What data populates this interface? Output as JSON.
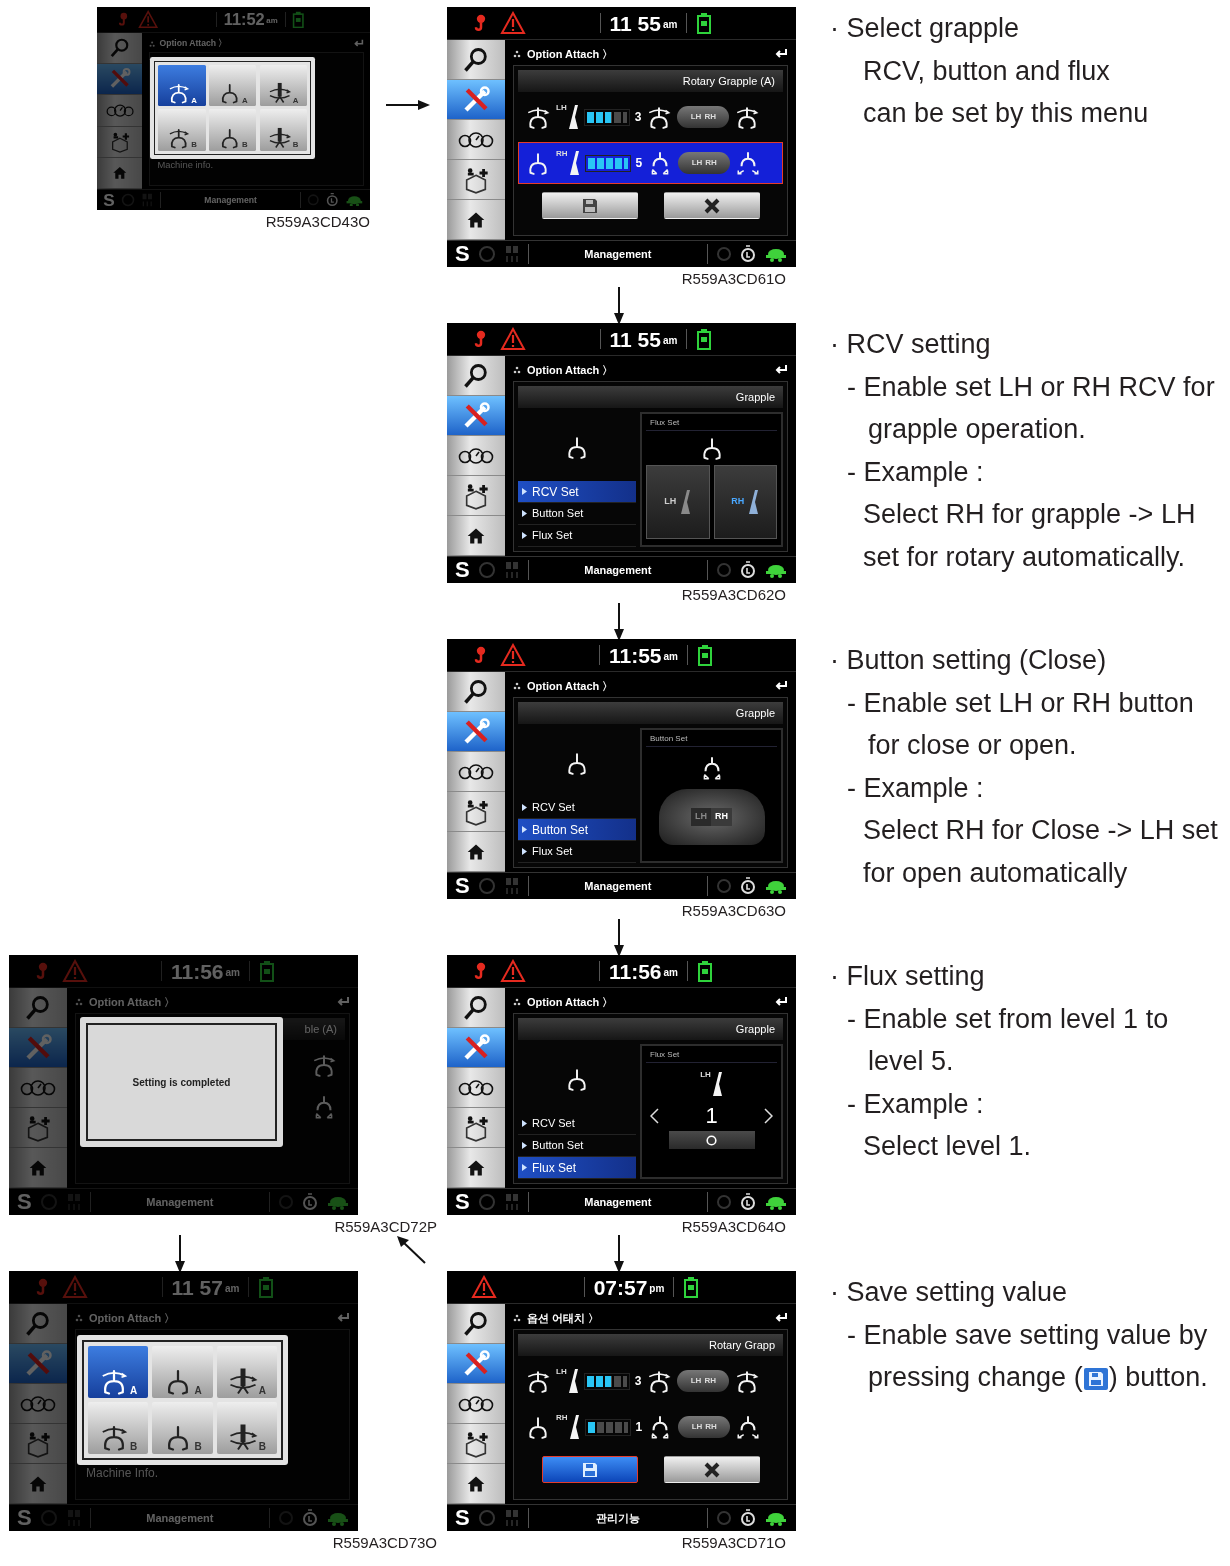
{
  "steps": [
    {
      "left": {
        "time": "11:52",
        "meridiem": "am",
        "hook_warning": true,
        "header": "Option Attach 〉",
        "footer_letter": "S",
        "footer": "Management",
        "dimmed": true,
        "sidebar": [
          {
            "selected": false
          },
          {
            "selected": true
          },
          {
            "selected": false
          },
          {
            "selected": false
          },
          {
            "selected": false
          }
        ],
        "content": {
          "kind": "list",
          "items": [
            "Machine info."
          ]
        },
        "popup": {
          "kind": "picker",
          "tiles": [
            {
              "kind": "rotary",
              "sub": "A",
              "selected": true
            },
            {
              "kind": "grapple",
              "sub": "A",
              "selected": false
            },
            {
              "kind": "rotator",
              "sub": "A",
              "selected": false
            },
            {
              "kind": "rotary",
              "sub": "B",
              "selected": false
            },
            {
              "kind": "grapple",
              "sub": "B",
              "selected": false
            },
            {
              "kind": "rotator",
              "sub": "B",
              "selected": false
            }
          ]
        },
        "caption": "R559A3CD43O"
      },
      "center": {
        "time": "11 55",
        "meridiem": "am",
        "hook_warning": true,
        "header": "Option Attach 〉",
        "footer_letter": "S",
        "footer": "Management",
        "dimmed": false,
        "sidebar": [
          {
            "selected": false
          },
          {
            "selected": true
          },
          {
            "selected": false
          },
          {
            "selected": false
          },
          {
            "selected": false
          }
        ],
        "content": {
          "kind": "rows",
          "title": "Rotary Grapple (A)",
          "rows": [
            {
              "kind": "rotation",
              "lever": "LH",
              "level": 0.6,
              "reading": "3",
              "switch": [
                "LH",
                "RH"
              ],
              "selected": false
            },
            {
              "kind": "grip",
              "lever": "RH",
              "level": 1,
              "reading": "5",
              "switch": [
                "LH",
                "RH"
              ],
              "selected": true
            }
          ],
          "save_selected": false
        },
        "caption": "R559A3CD61O"
      },
      "note": {
        "heading": "· Select grapple",
        "items": [
          {
            "kind": "plain",
            "text": "RCV, button and flux"
          },
          {
            "kind": "plain",
            "text": "can be set by this menu"
          }
        ]
      }
    },
    {
      "center": {
        "time": "11 55",
        "meridiem": "am",
        "hook_warning": true,
        "header": "Option Attach 〉",
        "footer_letter": "S",
        "footer": "Management",
        "dimmed": false,
        "sidebar": [
          {
            "selected": false
          },
          {
            "selected": true
          },
          {
            "selected": false
          },
          {
            "selected": false
          },
          {
            "selected": false
          }
        ],
        "content": {
          "kind": "menu",
          "title": "Grapple",
          "items": [
            {
              "label": "RCV Set",
              "selected": true
            },
            {
              "label": "Button Set",
              "selected": false
            },
            {
              "label": "Flux Set",
              "selected": false
            }
          ],
          "panel": {
            "kind": "rcv",
            "title": "Flux Set",
            "options": [
              {
                "label": "LH",
                "selected": false
              },
              {
                "label": "RH",
                "selected": true
              }
            ]
          }
        },
        "caption": "R559A3CD62O"
      },
      "note": {
        "heading": "· RCV setting",
        "items": [
          {
            "kind": "dash",
            "text": "- Enable set LH or RH RCV for grapple operation."
          },
          {
            "kind": "dash",
            "text": "- Example :"
          },
          {
            "kind": "plain",
            "text": "Select RH for grapple -> LH set for rotary automatically."
          }
        ]
      }
    },
    {
      "center": {
        "time": "11:55",
        "meridiem": "am",
        "hook_warning": true,
        "header": "Option Attach 〉",
        "footer_letter": "S",
        "footer": "Management",
        "dimmed": false,
        "sidebar": [
          {
            "selected": false
          },
          {
            "selected": true
          },
          {
            "selected": false
          },
          {
            "selected": false
          },
          {
            "selected": false
          }
        ],
        "content": {
          "kind": "menu",
          "title": "Grapple",
          "items": [
            {
              "label": "RCV Set",
              "selected": false
            },
            {
              "label": "Button Set",
              "selected": true
            },
            {
              "label": "Flux Set",
              "selected": false
            }
          ],
          "panel": {
            "kind": "button",
            "title": "Button Set",
            "options": [
              {
                "label": "LH",
                "selected": false
              },
              {
                "label": "RH",
                "selected": true
              }
            ]
          }
        },
        "caption": "R559A3CD63O"
      },
      "note": {
        "heading": "· Button setting (Close)",
        "items": [
          {
            "kind": "dash",
            "text": "- Enable set LH or RH button for close or open."
          },
          {
            "kind": "dash",
            "text": "- Example :"
          },
          {
            "kind": "plain",
            "text": "Select RH for Close -> LH set for open automatically"
          }
        ]
      }
    },
    {
      "left": {
        "time": "11:56",
        "meridiem": "am",
        "hook_warning": true,
        "header": "Option Attach 〉",
        "footer_letter": "S",
        "footer": "Management",
        "dimmed": true,
        "sidebar": [
          {
            "selected": false
          },
          {
            "selected": true
          },
          {
            "selected": false
          },
          {
            "selected": false
          },
          {
            "selected": false
          }
        ],
        "content": {
          "kind": "title-only",
          "title": "ble (A)"
        },
        "popup": {
          "kind": "message",
          "text": "Setting is completed"
        },
        "caption": "R559A3CD72P"
      },
      "center": {
        "time": "11:56",
        "meridiem": "am",
        "hook_warning": true,
        "header": "Option Attach 〉",
        "footer_letter": "S",
        "footer": "Management",
        "dimmed": false,
        "sidebar": [
          {
            "selected": false
          },
          {
            "selected": true
          },
          {
            "selected": false
          },
          {
            "selected": false
          },
          {
            "selected": false
          }
        ],
        "content": {
          "kind": "menu",
          "title": "Grapple",
          "items": [
            {
              "label": "RCV Set",
              "selected": false
            },
            {
              "label": "Button Set",
              "selected": false
            },
            {
              "label": "Flux Set",
              "selected": true
            }
          ],
          "panel": {
            "kind": "flux",
            "title": "Flux Set",
            "lever": "LH",
            "value": "1"
          }
        },
        "caption": "R559A3CD64O"
      },
      "note": {
        "heading": "· Flux setting",
        "items": [
          {
            "kind": "dash",
            "text": "- Enable set from level 1 to level 5."
          },
          {
            "kind": "dash",
            "text": "- Example :"
          },
          {
            "kind": "plain",
            "text": "Select level 1."
          }
        ]
      }
    },
    {
      "left": {
        "time": "11 57",
        "meridiem": "am",
        "hook_warning": true,
        "header": "Option Attach 〉",
        "footer_letter": "S",
        "footer": "Management",
        "dimmed": true,
        "sidebar": [
          {
            "selected": false
          },
          {
            "selected": true
          },
          {
            "selected": false
          },
          {
            "selected": false
          },
          {
            "selected": false
          }
        ],
        "content": {
          "kind": "list",
          "items": [
            "Machine Info."
          ]
        },
        "popup": {
          "kind": "picker",
          "tiles": [
            {
              "kind": "rotary",
              "sub": "A",
              "selected": true
            },
            {
              "kind": "grapple",
              "sub": "A",
              "selected": false
            },
            {
              "kind": "rotator",
              "sub": "A",
              "selected": false
            },
            {
              "kind": "rotary",
              "sub": "B",
              "selected": false
            },
            {
              "kind": "grapple",
              "sub": "B",
              "selected": false
            },
            {
              "kind": "rotator",
              "sub": "B",
              "selected": false
            }
          ]
        },
        "caption": "R559A3CD73O"
      },
      "center": {
        "time": "07:57",
        "meridiem": "pm",
        "hook_warning": false,
        "header": "옵션 어태치 〉",
        "footer_letter": "S",
        "footer": "관리기능",
        "dimmed": false,
        "sidebar": [
          {
            "selected": false
          },
          {
            "selected": true
          },
          {
            "selected": false
          },
          {
            "selected": false
          },
          {
            "selected": false
          }
        ],
        "content": {
          "kind": "rows",
          "title": "Rotary Grapp",
          "rows": [
            {
              "kind": "rotation",
              "lever": "LH",
              "level": 0.6,
              "reading": "3",
              "switch": [
                "LH",
                "RH"
              ],
              "selected": false
            },
            {
              "kind": "grip",
              "lever": "RH",
              "level": 0.2,
              "reading": "1",
              "switch": [
                "LH",
                "RH"
              ],
              "selected": false
            }
          ],
          "save_selected": true
        },
        "caption": "R559A3CD71O"
      },
      "note": {
        "heading": "· Save setting value",
        "items": [
          {
            "kind": "dash",
            "text": "- Enable save setting value by pressing change (",
            "text_after": ") button."
          }
        ]
      }
    }
  ]
}
